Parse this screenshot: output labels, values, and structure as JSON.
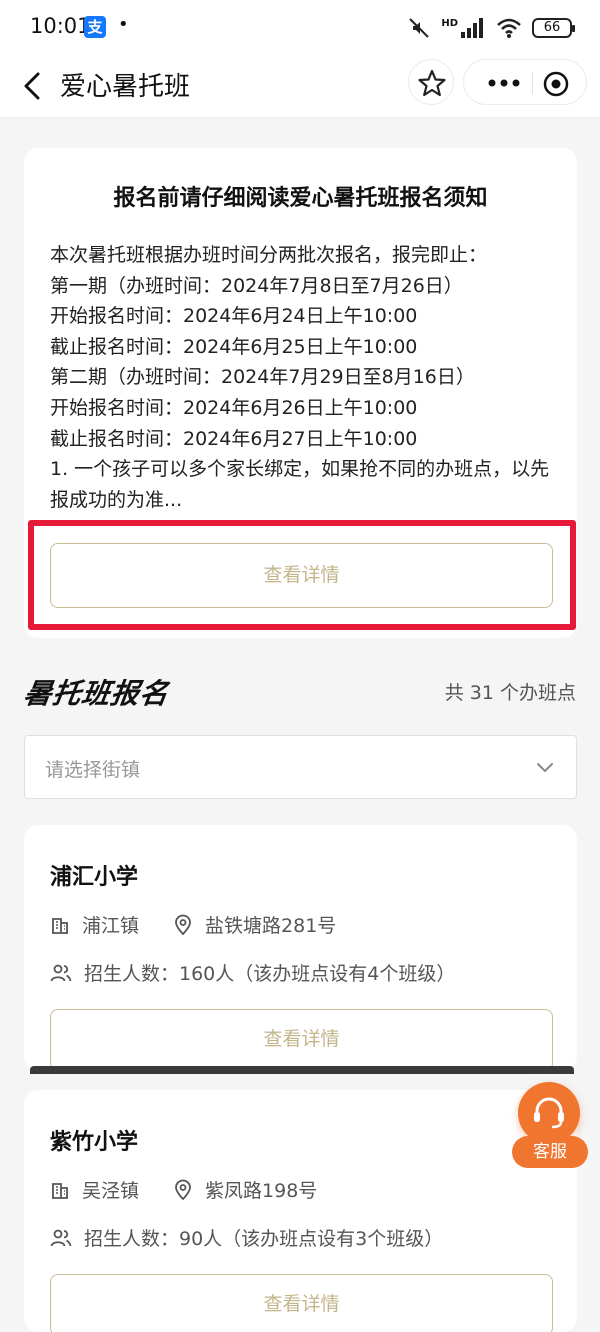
{
  "status_bar": {
    "time": "10:01",
    "app_badge": "支",
    "dot": "•",
    "hd_label": "HD",
    "battery": "66"
  },
  "nav": {
    "title": "爱心暑托班"
  },
  "notice": {
    "title": "报名前请仔细阅读爱心暑托班报名须知",
    "lines": [
      "本次暑托班根据办班时间分两批次报名，报完即止：",
      "第一期（办班时间：2024年7月8日至7月26日）",
      "开始报名时间：2024年6月24日上午10:00",
      "截止报名时间：2024年6月25日上午10:00",
      "第二期（办班时间：2024年7月29日至8月16日）",
      "开始报名时间：2024年6月26日上午10:00",
      "截止报名时间：2024年6月27日上午10:00",
      "1. 一个孩子可以多个家长绑定，如果抢不同的办班点，以先报成功的为准..."
    ],
    "detail_button": "查看详情"
  },
  "section": {
    "logo_text": "暑托班报名",
    "count_text": "共 31 个办班点"
  },
  "town_select": {
    "placeholder": "请选择街镇"
  },
  "schools": [
    {
      "name": "浦汇小学",
      "town": "浦江镇",
      "address": "盐铁塘路281号",
      "enrollment": "招生人数：160人（该办班点设有4个班级）",
      "detail_button": "查看详情"
    },
    {
      "name": "紫竹小学",
      "town": "吴泾镇",
      "address": "紫凤路198号",
      "enrollment": "招生人数：90人（该办班点设有3个班级）",
      "detail_button": "查看详情"
    }
  ],
  "customer_service": {
    "label": "客服"
  },
  "colors": {
    "accent_gold": "#c3b58a",
    "highlight_red": "#e51938",
    "service_orange": "#f0752f"
  }
}
